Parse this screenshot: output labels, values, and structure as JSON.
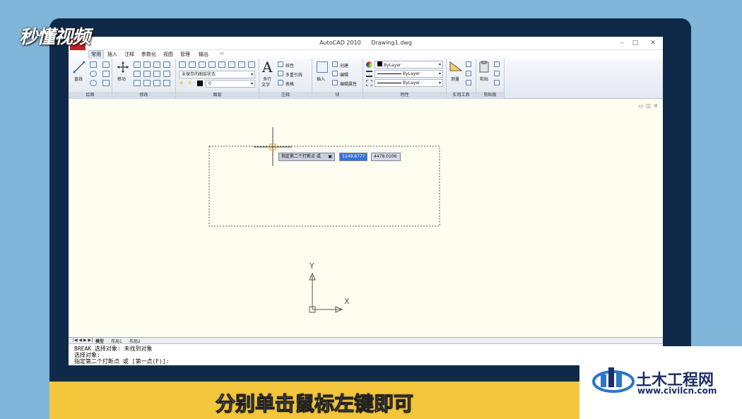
{
  "watermark": "秒懂视频",
  "window": {
    "app": "AutoCAD 2010",
    "file": "Drawing1.dwg"
  },
  "tabs": [
    "常用",
    "插入",
    "注释",
    "参数化",
    "视图",
    "管理",
    "输出"
  ],
  "ribbon": {
    "draw": {
      "line": "直线",
      "title": "绘图"
    },
    "modify": {
      "move": "移动",
      "title": "修改"
    },
    "layers": {
      "state": "未保存的图层状态",
      "layer": "0",
      "title": "图层"
    },
    "annotation": {
      "mtext_line1": "多行",
      "mtext_line2": "文字",
      "linear": "线性",
      "mleader": "多重引线",
      "table": "表格",
      "title": "注释"
    },
    "block": {
      "insert": "插入",
      "create": "创建",
      "edit": "编辑",
      "attr": "编辑属性",
      "title": "块"
    },
    "properties": {
      "color": "ByLayer",
      "linetype": "ByLayer",
      "lineweight": "ByLayer",
      "title": "特性"
    },
    "utilities": {
      "measure": "测量",
      "title": "实用工具"
    },
    "clipboard": {
      "paste": "粘贴",
      "title": "剪贴板"
    }
  },
  "layout_tabs": [
    "模型",
    "布局1",
    "布局2"
  ],
  "dynamic_input": {
    "prompt": "指定第二个打断点 或",
    "x_value": "1149.8777",
    "y_value": "4478.0106"
  },
  "ucs": {
    "x_label": "X",
    "y_label": "Y"
  },
  "command_lines": [
    "BREAK 选择对象: 未找到对象",
    "选择对象:",
    "指定第二个打断点 或 [第一点(F)]:"
  ],
  "subtitle": "分别单击鼠标左键即可",
  "site_logo": {
    "name": "土木工程网",
    "url": "www.civilcn.com"
  }
}
